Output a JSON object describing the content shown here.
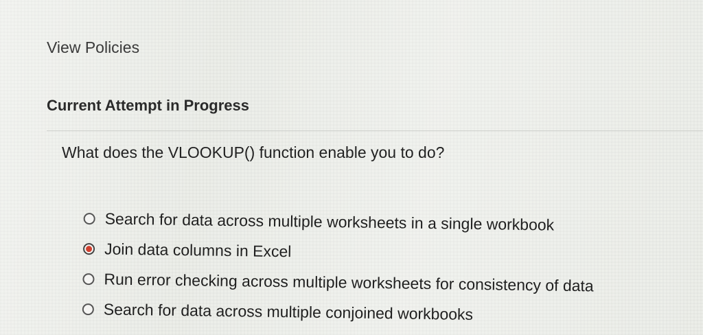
{
  "page": {
    "view_policies_label": "View Policies",
    "attempt_status": "Current Attempt in Progress"
  },
  "question": {
    "text": "What does the VLOOKUP() function enable you to do?",
    "selected_index": 1,
    "options": [
      {
        "label": "Search for data across multiple worksheets in a single workbook",
        "selected": false
      },
      {
        "label": "Join data columns in Excel",
        "selected": true
      },
      {
        "label": "Run error checking across multiple worksheets for consistency of data",
        "selected": false
      },
      {
        "label": "Search for data across multiple conjoined workbooks",
        "selected": false
      }
    ]
  },
  "colors": {
    "selected_radio": "#d0402f",
    "background": "#eceee9"
  }
}
